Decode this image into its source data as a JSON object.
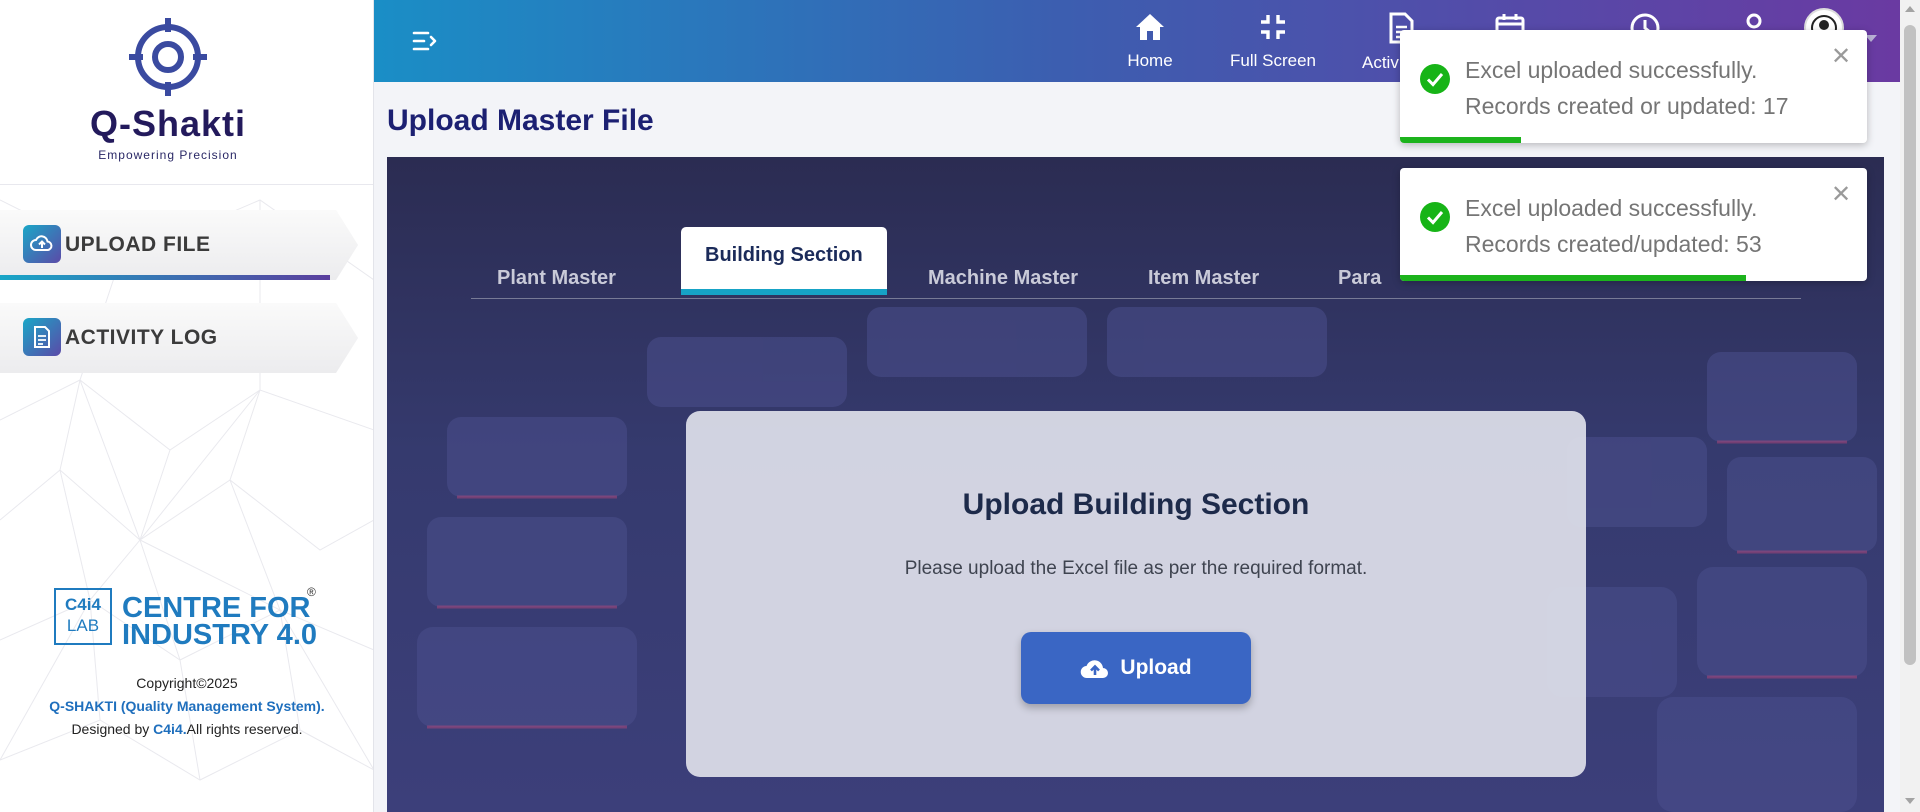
{
  "brand": {
    "name": "Q-Shakti",
    "tagline": "Empowering Precision"
  },
  "sidebar": {
    "items": [
      {
        "label": "UPLOAD FILE",
        "icon": "cloud-upload-icon",
        "active": true
      },
      {
        "label": "ACTIVITY LOG",
        "icon": "document-icon",
        "active": false
      }
    ]
  },
  "footer": {
    "c4_box_top": "C4i4",
    "c4_box_bottom": "LAB",
    "c4_name": "CENTRE FOR INDUSTRY 4.0",
    "registered": "®",
    "copyright": "Copyright©2025",
    "system_name": "Q-SHAKTI (Quality Management System).",
    "designed_by_prefix": "Designed by ",
    "designed_by_link": "C4i4.",
    "rights": "All rights reserved."
  },
  "topbar": {
    "buttons": [
      {
        "label": "Home",
        "icon": "home-icon"
      },
      {
        "label": "Full Screen",
        "icon": "fullscreen-exit-icon"
      },
      {
        "label": "Activi",
        "icon": "document-icon"
      }
    ],
    "icons": [
      "calendar-icon",
      "clock-icon",
      "user-icon",
      "avatar-icon"
    ]
  },
  "page": {
    "title": "Upload Master File"
  },
  "tabs": [
    {
      "label": "Plant Master",
      "active": false
    },
    {
      "label": "Building Section",
      "active": true
    },
    {
      "label": "Machine Master",
      "active": false
    },
    {
      "label": "Item Master",
      "active": false
    },
    {
      "label": "Para",
      "active": false
    }
  ],
  "upload_card": {
    "title": "Upload Building Section",
    "subtitle": "Please upload the Excel file as per the required format.",
    "button_label": "Upload"
  },
  "toasts": [
    {
      "line1": "Excel uploaded successfully.",
      "line2": "Records created or updated: 17",
      "progress": 0.26
    },
    {
      "line1": "Excel uploaded successfully.",
      "line2": "Records created/updated: 53",
      "progress": 0.74
    }
  ],
  "colors": {
    "brand_navy": "#1c2072",
    "topbar_start": "#1a8ec6",
    "topbar_end": "#6a3aa2",
    "tab_accent": "#16a3c6",
    "upload_button": "#3a66c4",
    "success": "#1cb31c"
  }
}
